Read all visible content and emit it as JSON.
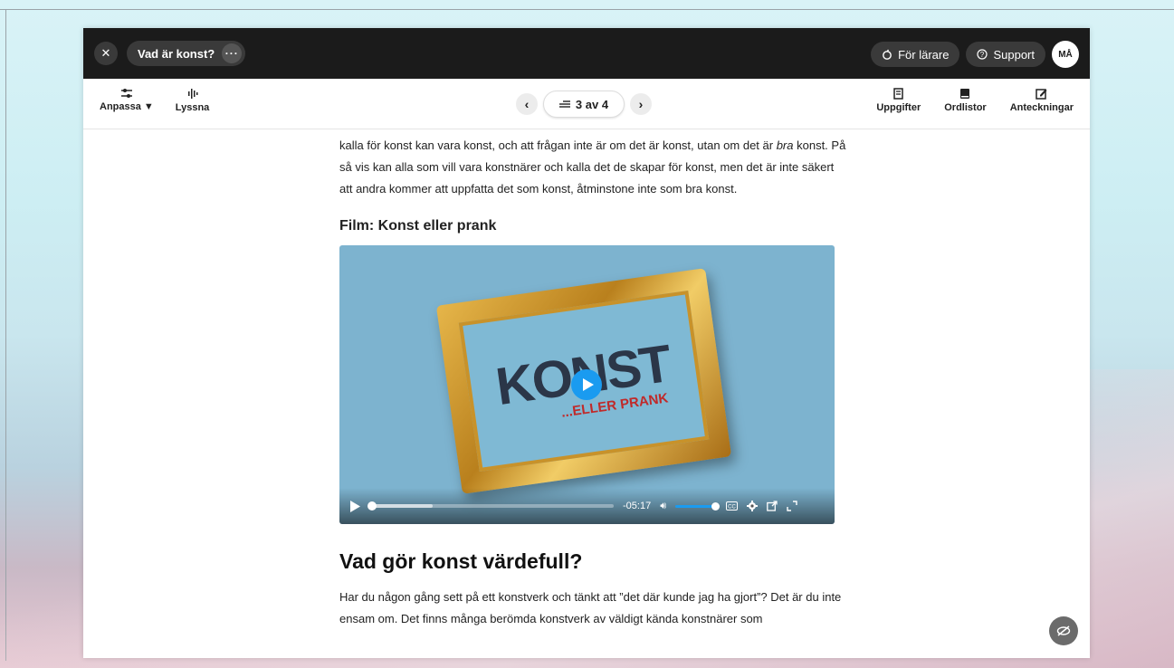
{
  "topbar": {
    "close_label": "✕",
    "title": "Vad är konst?",
    "more_label": "···",
    "teacher_label": "För lärare",
    "support_label": "Support",
    "avatar_initials": "MÅ"
  },
  "toolbar": {
    "adjust_label": "Anpassa ▼",
    "listen_label": "Lyssna",
    "pager_label": "3 av 4",
    "tasks_label": "Uppgifter",
    "wordlists_label": "Ordlistor",
    "notes_label": "Anteckningar"
  },
  "article": {
    "para1_before_em": "kalla för konst kan vara konst, och att frågan inte är om det är konst, utan om det är ",
    "para1_em": "bra",
    "para1_after_em": " konst. På så vis kan alla som vill vara konstnärer och kalla det de skapar för konst, men det är inte säkert att andra kommer att uppfatta det som konst, åtminstone inte som bra konst.",
    "film_heading": "Film: Konst eller prank",
    "video": {
      "thumb_title": "KONST",
      "thumb_subtitle": "...ELLER PRANK",
      "time_remaining": "-05:17",
      "progress_fraction": 0.0,
      "buffered_fraction": 0.26,
      "volume_fraction": 1.0
    },
    "heading2": "Vad gör konst värdefull?",
    "para2": "Har du någon gång sett på ett konstverk och tänkt att ”det där kunde jag ha gjort”? Det är du inte ensam om. Det finns många berömda konstverk av väldigt kända konstnärer som"
  },
  "colors": {
    "topbar_bg": "#1b1b1b",
    "accent_blue": "#1a9bf0",
    "video_bg": "#7db3cf"
  }
}
